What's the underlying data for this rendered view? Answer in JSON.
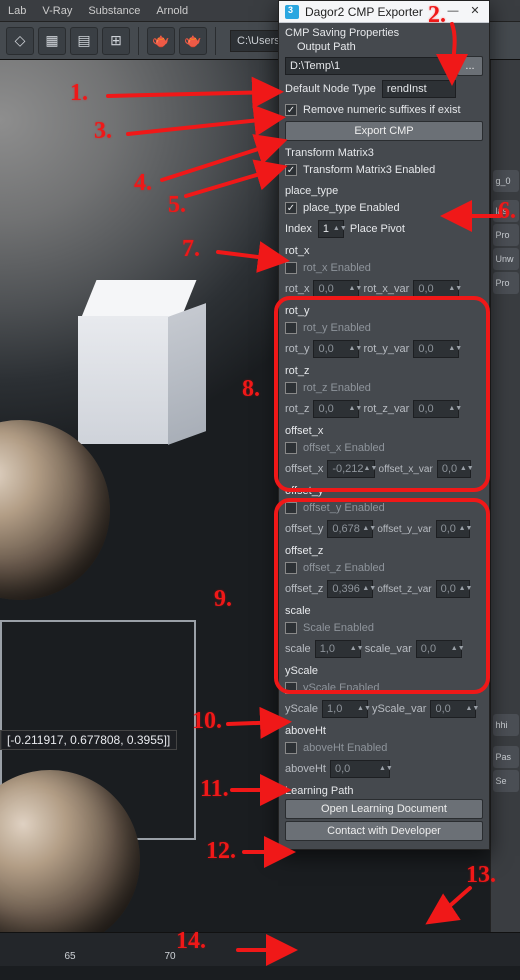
{
  "app": {
    "menus": [
      "Lab",
      "V-Ray",
      "Substance",
      "Arnold"
    ],
    "project_path": "C:\\Users\\"
  },
  "coords": "[-0.211917, 0.677808, 0.3955]]",
  "timeline": {
    "ticks": [
      "65",
      "70"
    ]
  },
  "right_tabs": [
    "las",
    "Pro",
    "Unw",
    "Pro",
    "hhi",
    "Pas",
    "Se"
  ],
  "panel": {
    "title": "Dagor2 CMP Exporter",
    "saving_header": "CMP Saving Properties",
    "output_path_label": "Output Path",
    "output_path": "D:\\Temp\\1",
    "browse_label": "...",
    "default_node_type_label": "Default Node Type",
    "default_node_type": "rendInst",
    "remove_suffixes_label": "Remove numeric suffixes if exist",
    "export_button": "Export CMP",
    "tm3": {
      "header": "Transform Matrix3",
      "enabled_label": "Transform Matrix3 Enabled"
    },
    "place_type": {
      "header": "place_type",
      "enabled_label": "place_type Enabled",
      "index_label": "Index",
      "index_value": "1",
      "pivot_label": "Place Pivot"
    },
    "rot_x": {
      "header": "rot_x",
      "enabled_label": "rot_x Enabled",
      "val_label": "rot_x",
      "val": "0,0",
      "var_label": "rot_x_var",
      "var": "0,0"
    },
    "rot_y": {
      "header": "rot_y",
      "enabled_label": "rot_y Enabled",
      "val_label": "rot_y",
      "val": "0,0",
      "var_label": "rot_y_var",
      "var": "0,0"
    },
    "rot_z": {
      "header": "rot_z",
      "enabled_label": "rot_z Enabled",
      "val_label": "rot_z",
      "val": "0,0",
      "var_label": "rot_z_var",
      "var": "0,0"
    },
    "offset_x": {
      "header": "offset_x",
      "enabled_label": "offset_x Enabled",
      "val_label": "offset_x",
      "val": "-0,212",
      "var_label": "offset_x_var",
      "var": "0,0"
    },
    "offset_y": {
      "header": "offset_y",
      "enabled_label": "offset_y Enabled",
      "val_label": "offset_y",
      "val": "0,678",
      "var_label": "offset_y_var",
      "var": "0,0"
    },
    "offset_z": {
      "header": "offset_z",
      "enabled_label": "offset_z Enabled",
      "val_label": "offset_z",
      "val": "0,396",
      "var_label": "offset_z_var",
      "var": "0,0"
    },
    "scale": {
      "header": "scale",
      "enabled_label": "Scale Enabled",
      "val_label": "scale",
      "val": "1,0",
      "var_label": "scale_var",
      "var": "0,0"
    },
    "yscale": {
      "header": "yScale",
      "enabled_label": "yScale Enabled",
      "val_label": "yScale",
      "val": "1,0",
      "var_label": "yScale_var",
      "var": "0,0"
    },
    "aboveht": {
      "header": "aboveHt",
      "enabled_label": "aboveHt Enabled",
      "val_label": "aboveHt",
      "val": "0,0"
    },
    "learning": {
      "header": "Learning Path",
      "doc_button": "Open Learning Document",
      "contact_button": "Contact with Developer"
    }
  },
  "annotations": {
    "n1": "1.",
    "n2": "2.",
    "n3": "3.",
    "n4": "4.",
    "n5": "5.",
    "n6": "6.",
    "n7": "7.",
    "n8": "8.",
    "n9": "9.",
    "n10": "10.",
    "n11": "11.",
    "n12": "12.",
    "n13": "13.",
    "n14": "14."
  },
  "tool_right_fragment": "g_0"
}
